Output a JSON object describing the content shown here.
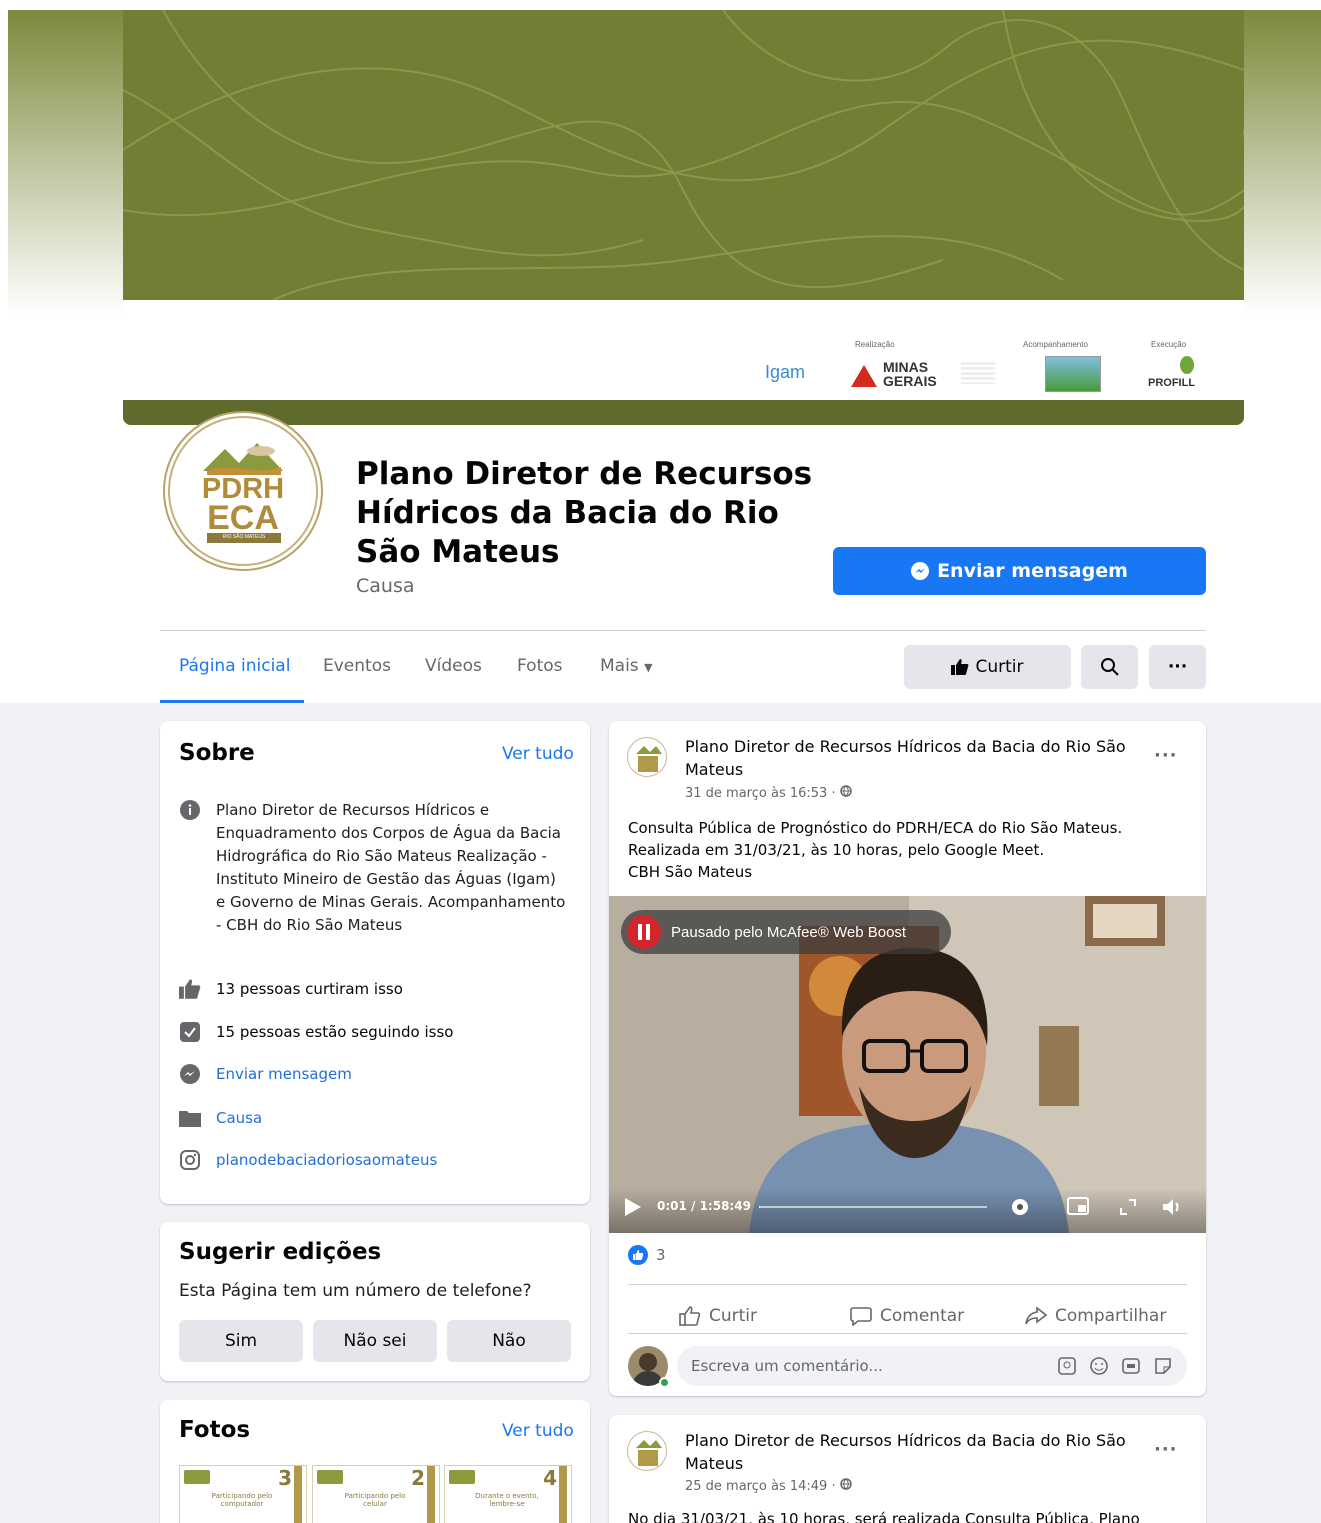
{
  "page": {
    "title": "Plano Diretor de Recursos Hídricos da Bacia do Rio São Mateus",
    "category": "Causa",
    "send_message": "Enviar mensagem"
  },
  "cover": {
    "captions": {
      "realizacao": "Realização",
      "acompanhamento": "Acompanhamento",
      "execucao": "Execução"
    },
    "logos": {
      "igam": "Igam",
      "minas_line1": "MINAS",
      "minas_line2": "GERAIS",
      "profill": "PROFILL"
    }
  },
  "avatar": {
    "line1": "PDRH",
    "line2": "ECA",
    "band": "RIO SÃO MATEUS"
  },
  "tabs": [
    {
      "label": "Página inicial"
    },
    {
      "label": "Eventos"
    },
    {
      "label": "Vídeos"
    },
    {
      "label": "Fotos"
    },
    {
      "label": "Mais"
    }
  ],
  "actions": {
    "like": "Curtir"
  },
  "about": {
    "title": "Sobre",
    "see_all": "Ver tudo",
    "description": "Plano Diretor de Recursos Hídricos e Enquadramento dos Corpos de Água da Bacia Hidrográfica do Rio São Mateus Realização - Instituto Mineiro de Gestão das Águas (Igam) e Governo de Minas Gerais. Acompanhamento - CBH do Rio São Mateus",
    "likes": "13 pessoas curtiram isso",
    "followers": "15 pessoas estão seguindo isso",
    "send_message": "Enviar mensagem",
    "category": "Causa",
    "instagram": "planodebaciadoriosaomateus"
  },
  "suggest": {
    "title": "Sugerir edições",
    "question": "Esta Página tem um número de telefone?",
    "yes": "Sim",
    "dont_know": "Não sei",
    "no": "Não"
  },
  "photos": {
    "title": "Fotos",
    "see_all": "Ver tudo",
    "thumbs": [
      {
        "number": "3",
        "caption": "Participando pelo computador"
      },
      {
        "number": "2",
        "caption": "Participando pelo celular"
      },
      {
        "number": "4",
        "caption": "Durante o evento, lembre-se"
      }
    ]
  },
  "posts": [
    {
      "author": "Plano Diretor de Recursos Hídricos da Bacia do Rio São Mateus",
      "date": "31 de março às 16:53 · ",
      "text": "Consulta Pública de Prognóstico do PDRH/ECA do Rio São Mateus. Realizada em 31/03/21, às 10 horas, pelo Google Meet.",
      "tag": "CBH São Mateus",
      "paused_banner": "Pausado pelo McAfee® Web Boost",
      "video_time": "0:01 / 1:58:49",
      "video_progress": 0.0001,
      "reactions": "3",
      "like": "Curtir",
      "comment": "Comentar",
      "share": "Compartilhar",
      "comment_placeholder": "Escreva um comentário..."
    },
    {
      "author": "Plano Diretor de Recursos Hídricos da Bacia do Rio São Mateus",
      "date": "25 de março às 14:49 · ",
      "text": "No dia 31/03/21, às 10 horas, será realizada Consulta Pública, Plano"
    }
  ]
}
